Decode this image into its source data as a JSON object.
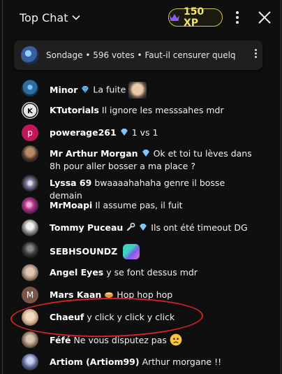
{
  "header": {
    "title": "Top Chat",
    "xp": "150 XP"
  },
  "poll": {
    "text": "Sondage • 596 votes • Faut-il censurer quelqu'un ..."
  },
  "messages": [
    {
      "name": "Minor",
      "text": "La fuite",
      "avatar_color": "#2e6e9e"
    },
    {
      "name": "KTutorials",
      "text": "Il ignore les messsahes mdr",
      "avatar_color": "#e6e6e6"
    },
    {
      "name": "powerage261",
      "text": "1 vs 1",
      "avatar_color": "#c2185b",
      "avatar_letter": "p"
    },
    {
      "name": "Mr Arthur Morgan",
      "text": "Ok et toi tu lèves dans 8h pour aller bosser a ma place ?",
      "avatar_color": "#6b4a3a"
    },
    {
      "name": "Lyssa 69",
      "text": "bwaaaahahaha genre il bosse demain",
      "avatar_color": "#8a7fa8"
    },
    {
      "name": "MrMoapi",
      "text": "Il assume pas, il fuit",
      "avatar_color": "#b03a8a"
    },
    {
      "name": "Tommy Puceau",
      "text": "Ils ont été timeout DG",
      "avatar_color": "#d8d8d8"
    },
    {
      "name": "SEBHSOUNDZ",
      "text": "",
      "avatar_color": "#3a3a3a"
    },
    {
      "name": "Angel Eyes",
      "text": "y se font dessus mdr",
      "avatar_color": "#c9b8a8"
    },
    {
      "name": "Mars Kaan",
      "text": "Hop hop hop",
      "avatar_color": "#795548",
      "avatar_letter": "M"
    },
    {
      "name": "Chaeuf",
      "text": "y click y click y click",
      "avatar_color": "#d9c7b0"
    },
    {
      "name": "Féfé",
      "text": "Ne vous disputez pas",
      "avatar_color": "#a08a7a"
    },
    {
      "name": "Artiom (Artiom99)",
      "text": "Arthur morgane !!",
      "avatar_color": "#5a6a9a"
    }
  ],
  "colors": {
    "accent_xp": "#f4e16a",
    "highlight": "#d3222a",
    "background": "#0f0f0f"
  }
}
